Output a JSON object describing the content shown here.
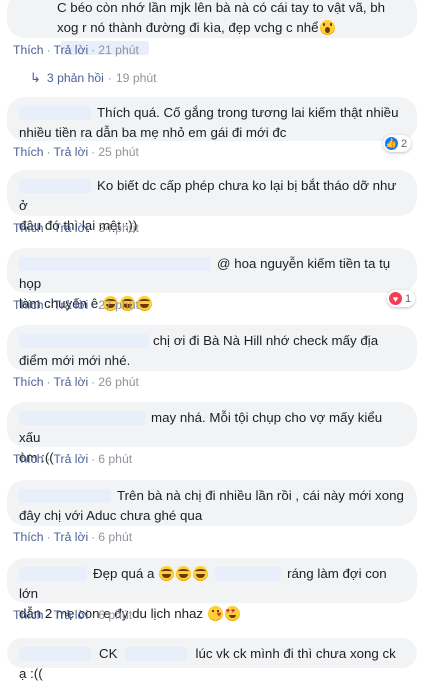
{
  "labels": {
    "like": "Thích",
    "reply": "Trả lời",
    "dot": "·"
  },
  "comments": [
    {
      "text_a": "C béo còn nhớ lần mjk lên bà nà có cái tay to vật vã, bh",
      "text_b": "xog r nó thành đường đi kìa, đẹp vchg c nhể",
      "time": "21 phút"
    },
    {
      "text_a": "Thích quá. Cố gắng trong tương lai kiếm thật nhiều",
      "text_b": "nhiều tiền ra dẫn ba mẹ nhỏ em gái đi mới đc",
      "time": "25 phút",
      "reaction_count": "2"
    },
    {
      "text_a": "Ko biết dc cấp phép chưa ko lại bị bắt tháo dỡ như ở",
      "text_b": "đâu đó thì lại mệt :))",
      "time": "34 phút"
    },
    {
      "text_a": "@ hoa nguyễn kiếm tiền ta tụ họp",
      "text_b": "làm chuyến ê",
      "time": "27 phút",
      "reaction_count": "1"
    },
    {
      "text_a": "chị ơi đi Bà Nà Hill nhớ check mấy địa",
      "text_b": "điểm mới mới nhé.",
      "time": "26 phút"
    },
    {
      "text_a": "may nhá. Mỗi tội chụp cho vợ mấy kiểu xấu",
      "text_b": "òm :((",
      "time": "6 phút"
    },
    {
      "text_a": "Trên bà nà chị đi nhiều lần rồi , cái này mới xong",
      "text_b": "đây chị với Aduc chưa ghé qua",
      "time": "6 phút"
    },
    {
      "text_a": "Đẹp quá a",
      "text_a2": "ráng làm đợi con lớn",
      "text_b": "dẫn 2 mẹ con e đy du lịch nhaz",
      "time": "6 phút"
    },
    {
      "text_a": "CK",
      "text_a2": "lúc vk ck mình đi thì chưa xong ck ạ :(("
    }
  ],
  "replies": {
    "label": "3 phản hồi",
    "time": "19 phút"
  },
  "colors": {
    "link": "#4a6197",
    "bubble": "#f2f3f5",
    "like_blue": "#1877f2",
    "heart_red": "#f33e58"
  },
  "icons": [
    "reply-arrow-icon",
    "like-icon",
    "heart-icon",
    "wow-emoji-icon",
    "laugh-emoji-icon",
    "kiss-emoji-icon",
    "heart-eyes-emoji-icon"
  ]
}
